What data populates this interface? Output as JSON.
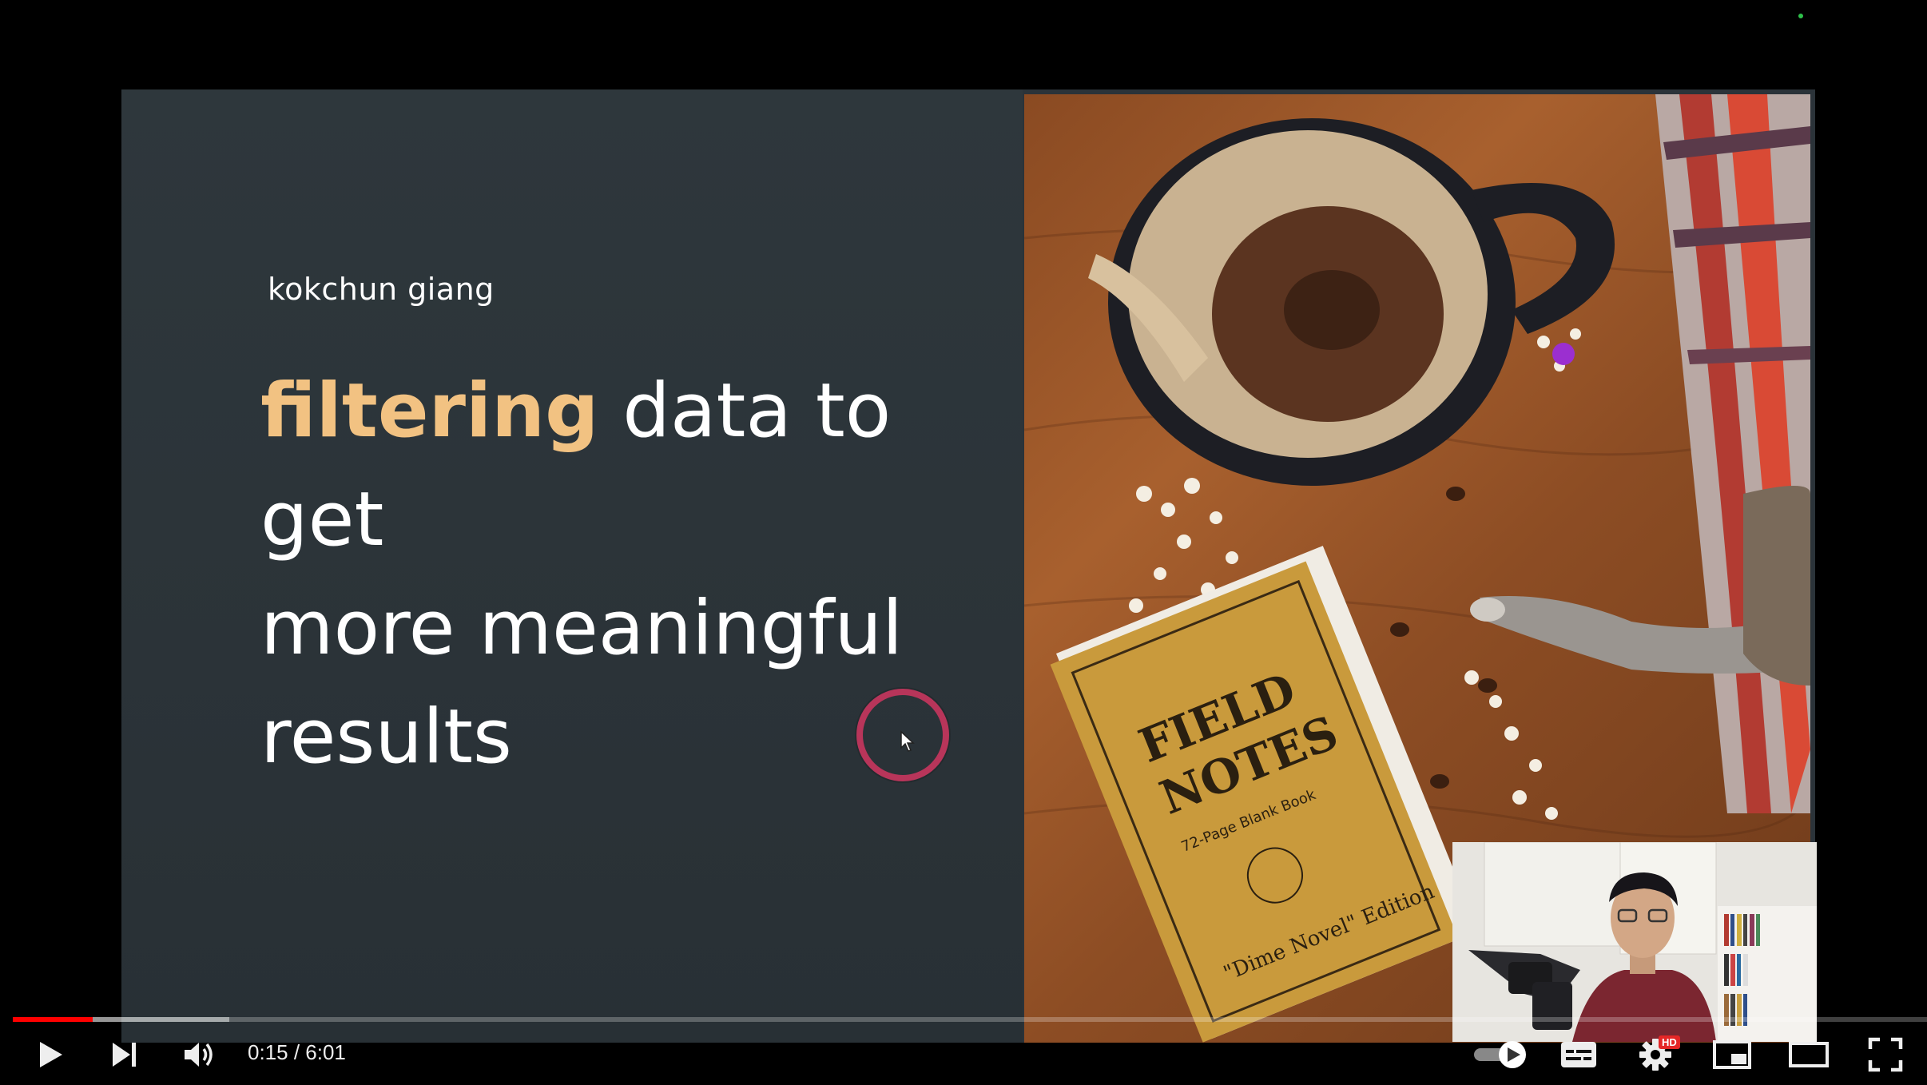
{
  "slide": {
    "author": "kokchun giang",
    "headline_highlight": "filtering",
    "headline_rest_1": " data to get",
    "headline_line_2": "more meaningful",
    "headline_line_3": "results",
    "highlight_color": "#f2c282",
    "background_color": "#2b3339"
  },
  "photo": {
    "book_title_1": "FIELD",
    "book_title_2": "NOTES",
    "book_subtitle": "72-Page Blank Book",
    "book_edition": "\"Dime Novel\" Edition"
  },
  "player": {
    "current_time": "0:15",
    "separator": " / ",
    "duration": "6:01",
    "progress_fraction": 0.0416,
    "buffered_fraction": 0.113,
    "quality_badge": "HD",
    "accent_color": "#ff0000",
    "icons": [
      "play-icon",
      "next-icon",
      "volume-icon",
      "autoplay-toggle-icon",
      "subtitles-icon",
      "settings-icon",
      "miniplayer-icon",
      "theater-icon",
      "fullscreen-icon"
    ]
  }
}
